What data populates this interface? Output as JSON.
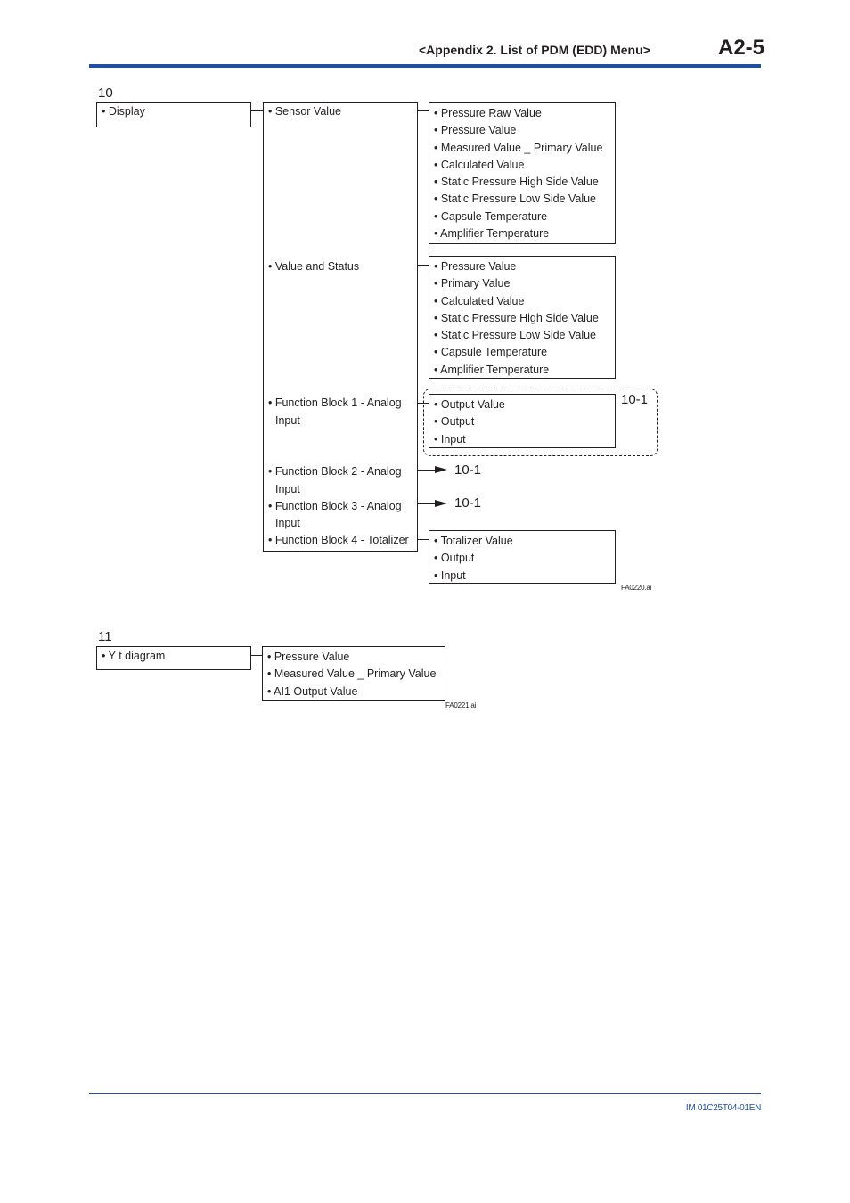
{
  "header": {
    "title": "<Appendix 2.  List of PDM (EDD) Menu>",
    "page": "A2-5",
    "accent_color": "#1f4fa0"
  },
  "section10": {
    "number": "10",
    "root": "• Display",
    "level2": {
      "sensor_value": "• Sensor Value",
      "value_and_status": "• Value and Status",
      "fb1_line1": "• Function Block 1 - Analog",
      "fb1_line2": "Input",
      "fb2_line1": "• Function Block 2 - Analog",
      "fb2_line2": "Input",
      "fb3_line1": "• Function Block 3 - Analog",
      "fb3_line2": "Input",
      "fb4": "• Function Block 4 - Totalizer"
    },
    "sensor_value_items": [
      "• Pressure Raw Value",
      "• Pressure Value",
      "• Measured Value _ Primary Value",
      "• Calculated Value",
      "• Static Pressure High Side Value",
      "• Static Pressure Low Side Value",
      "• Capsule Temperature",
      "• Amplifier Temperature"
    ],
    "value_and_status_items": [
      "• Pressure Value",
      "• Primary Value",
      "• Calculated Value",
      "• Static Pressure High Side Value",
      "• Static Pressure Low Side Value",
      "• Capsule Temperature",
      "• Amplifier Temperature"
    ],
    "fb1_items": [
      "• Output Value",
      "• Output",
      "• Input"
    ],
    "fb1_group_label": "10-1",
    "fb2_ref": "10-1",
    "fb3_ref": "10-1",
    "fb4_items": [
      "• Totalizer Value",
      "• Output",
      "• Input"
    ],
    "figure_id": "FA0220.ai"
  },
  "section11": {
    "number": "11",
    "root": "• Y t diagram",
    "items": [
      "• Pressure Value",
      "• Measured Value _ Primary Value",
      "• AI1 Output Value"
    ],
    "figure_id": "FA0221.ai"
  },
  "footer": {
    "doc_number": "IM 01C25T04-01EN"
  }
}
